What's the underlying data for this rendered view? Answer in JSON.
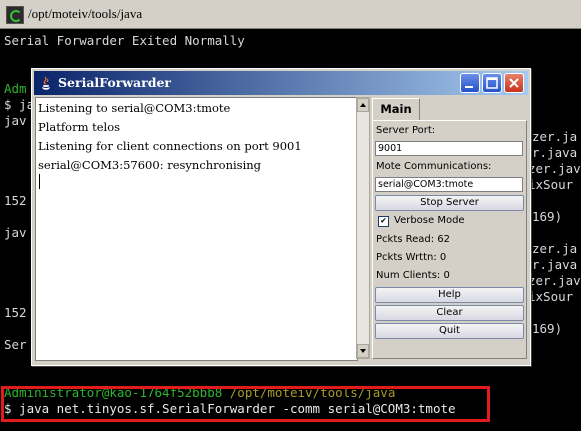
{
  "terminal": {
    "title": "/opt/moteiv/tools/java",
    "lines": [
      {
        "text": "Serial Forwarder Exited Normally",
        "color": "#d8d8d8"
      },
      {
        "text": "Adm",
        "color": "#2fb32f"
      },
      {
        "text": "$ ja",
        "color": "#d8d8d8"
      },
      {
        "text": "jav",
        "color": "#d8d8d8"
      },
      {
        "text": "152",
        "color": "#d8d8d8"
      },
      {
        "text": "jav",
        "color": "#d8d8d8"
      },
      {
        "text": "152",
        "color": "#d8d8d8"
      },
      {
        "text": "Ser",
        "color": "#d8d8d8"
      }
    ],
    "right_fragments": [
      "zer.ja",
      "r.java",
      "zer.java",
      "ixSour",
      "169)",
      "zer.ja",
      "r.java",
      "zer.java",
      "ixSour",
      "169)"
    ],
    "prompt": {
      "user": "Administrator@kao-1764f52bbb8",
      "path": "/opt/moteiv/tools/java",
      "command": "$ java net.tinyos.sf.SerialForwarder -comm serial@COM3:tmote"
    }
  },
  "serial_forwarder": {
    "title": "SerialForwarder",
    "log": [
      "Listening to serial@COM3:tmote",
      "Platform telos",
      "Listening for client connections on port 9001",
      "serial@COM3:57600: resynchronising"
    ],
    "tab_label": "Main",
    "server_port_label": "Server Port:",
    "server_port_value": "9001",
    "mote_comm_label": "Mote Communications:",
    "mote_comm_value": "serial@COM3:tmote",
    "stop_server_label": "Stop Server",
    "verbose_label": "Verbose Mode",
    "verbose_checked": true,
    "pckts_read": "Pckts Read: 62",
    "pckts_wrttn": "Pckts Wrttn: 0",
    "num_clients": "Num Clients: 0",
    "help_label": "Help",
    "clear_label": "Clear",
    "quit_label": "Quit"
  }
}
